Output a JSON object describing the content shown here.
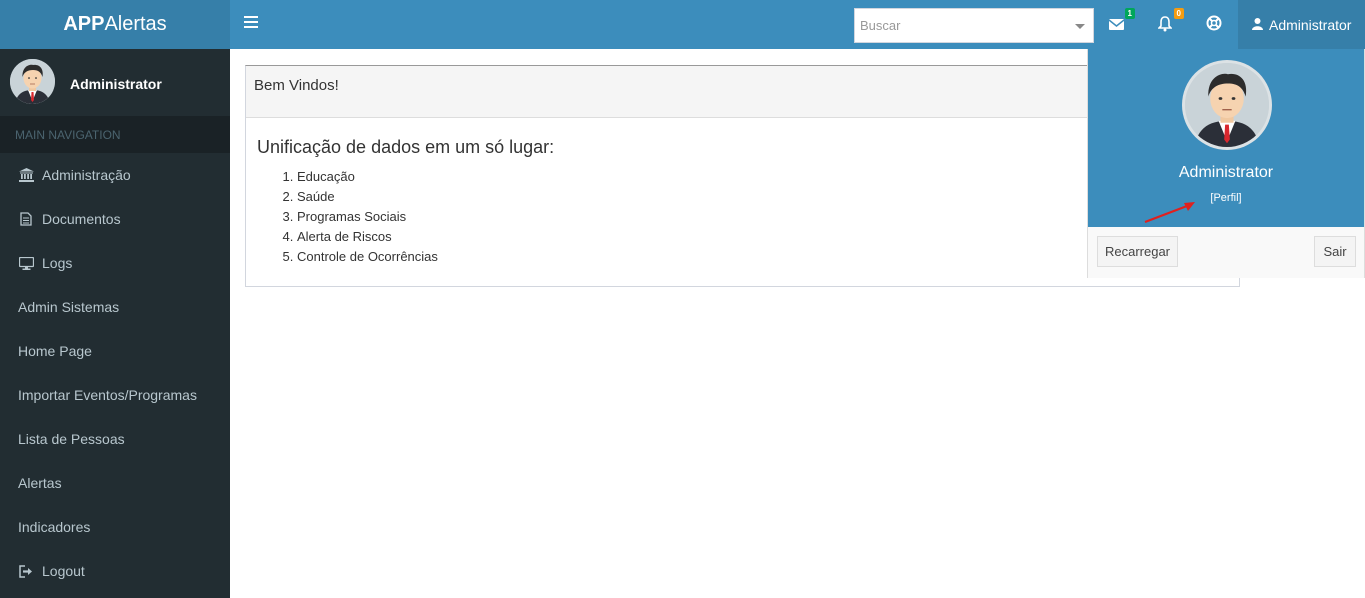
{
  "app": {
    "logo_bold": "APP",
    "logo_light": "Alertas"
  },
  "header": {
    "search_placeholder": "Buscar",
    "messages_count": "1",
    "notifications_count": "0",
    "user_name": "Administrator"
  },
  "sidebar": {
    "user_name": "Administrator",
    "nav_header": "MAIN NAVIGATION",
    "items": [
      {
        "label": "Administração",
        "icon": "bank-icon"
      },
      {
        "label": "Documentos",
        "icon": "document-icon"
      },
      {
        "label": "Logs",
        "icon": "monitor-icon"
      },
      {
        "label": "Admin Sistemas",
        "icon": ""
      },
      {
        "label": "Home Page",
        "icon": ""
      },
      {
        "label": "Importar Eventos/Programas",
        "icon": ""
      },
      {
        "label": "Lista de Pessoas",
        "icon": ""
      },
      {
        "label": "Alertas",
        "icon": ""
      },
      {
        "label": "Indicadores",
        "icon": ""
      },
      {
        "label": "Logout",
        "icon": "sign-out-icon"
      }
    ]
  },
  "main": {
    "panel_title": "Bem Vindos!",
    "heading": "Unificação de dados em um só lugar:",
    "list": [
      "Educação",
      "Saúde",
      "Programas Sociais",
      "Alerta de Riscos",
      "Controle de Ocorrências"
    ]
  },
  "dropdown": {
    "name": "Administrator",
    "profile_link": "[Perfil]",
    "reload_button": "Recarregar",
    "exit_button": "Sair"
  },
  "colors": {
    "header": "#3c8dbc",
    "header_dark": "#367fa9",
    "sidebar": "#222d32",
    "badge_green": "#00a65a",
    "badge_orange": "#f39c12"
  }
}
